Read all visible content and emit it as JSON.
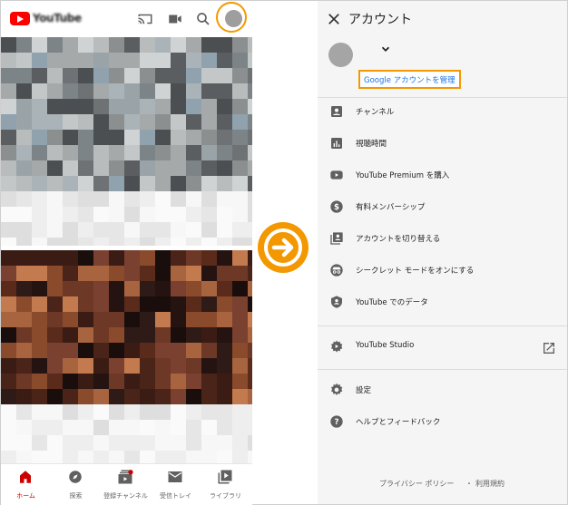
{
  "left_app": {
    "logo_text": "YouTube",
    "top_icons": [
      "cast-icon",
      "video-camera-icon",
      "search-icon",
      "account-avatar"
    ],
    "bottom_nav": [
      {
        "label": "ホーム",
        "icon": "home-icon",
        "active": true
      },
      {
        "label": "探索",
        "icon": "explore-icon",
        "active": false
      },
      {
        "label": "登録チャンネル",
        "icon": "subscriptions-icon",
        "active": false
      },
      {
        "label": "受信トレイ",
        "icon": "inbox-icon",
        "active": false
      },
      {
        "label": "ライブラリ",
        "icon": "library-icon",
        "active": false
      }
    ]
  },
  "account_panel": {
    "title": "アカウント",
    "google_account_button": "Google アカウントを管理",
    "menu_section_1": [
      {
        "label": "チャンネル",
        "icon": "channel-icon"
      },
      {
        "label": "視聴時間",
        "icon": "watch-time-icon"
      },
      {
        "label": "YouTube Premium を購入",
        "icon": "youtube-premium-icon"
      },
      {
        "label": "有料メンバーシップ",
        "icon": "paid-membership-icon"
      },
      {
        "label": "アカウントを切り替える",
        "icon": "switch-account-icon"
      },
      {
        "label": "シークレット モードをオンにする",
        "icon": "incognito-icon"
      },
      {
        "label": "YouTube でのデータ",
        "icon": "your-data-icon"
      }
    ],
    "menu_section_2": [
      {
        "label": "YouTube Studio",
        "icon": "studio-icon"
      }
    ],
    "menu_section_3": [
      {
        "label": "設定",
        "icon": "settings-icon"
      },
      {
        "label": "ヘルプとフィードバック",
        "icon": "help-icon"
      }
    ],
    "footer": {
      "privacy": "プライバシー ポリシー",
      "separator": "・",
      "terms": "利用規約"
    }
  },
  "colors": {
    "highlight_orange": "#f39800",
    "youtube_red": "#ff0000",
    "link_blue": "#1a73e8",
    "panel_bg": "#f5f5f5"
  }
}
